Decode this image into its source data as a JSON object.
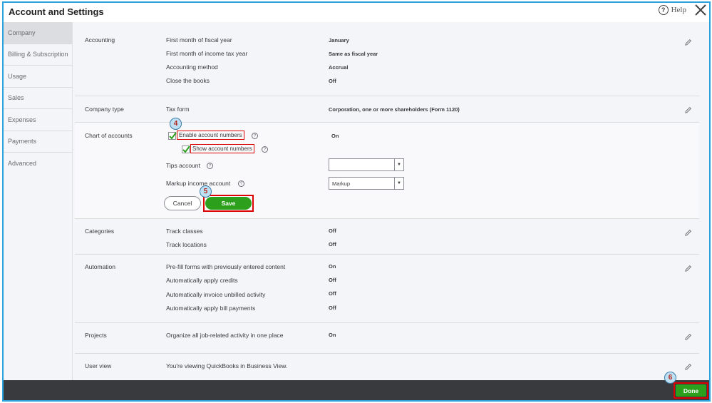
{
  "window": {
    "title": "Account and Settings",
    "help_label": "Help"
  },
  "sidebar": {
    "items": [
      {
        "label": "Company",
        "active": true
      },
      {
        "label": "Billing & Subscription"
      },
      {
        "label": "Usage"
      },
      {
        "label": "Sales"
      },
      {
        "label": "Expenses"
      },
      {
        "label": "Payments"
      },
      {
        "label": "Advanced"
      }
    ]
  },
  "accounting": {
    "label": "Accounting",
    "rows": [
      {
        "label": "First month of fiscal year",
        "value": "January"
      },
      {
        "label": "First month of income tax year",
        "value": "Same as fiscal year"
      },
      {
        "label": "Accounting method",
        "value": "Accrual"
      },
      {
        "label": "Close the books",
        "value": "Off"
      }
    ]
  },
  "company_type": {
    "label": "Company type",
    "row_label": "Tax form",
    "value": "Corporation, one or more shareholders (Form 1120)"
  },
  "chart_of_accounts": {
    "label": "Chart of accounts",
    "enable_label": "Enable account numbers",
    "enable_value": "On",
    "show_label": "Show account numbers",
    "tips_label": "Tips account",
    "tips_value": "",
    "markup_label": "Markup income account",
    "markup_value": "Markup",
    "cancel_label": "Cancel",
    "save_label": "Save"
  },
  "categories": {
    "label": "Categories",
    "rows": [
      {
        "label": "Track classes",
        "value": "Off"
      },
      {
        "label": "Track locations",
        "value": "Off"
      }
    ]
  },
  "automation": {
    "label": "Automation",
    "rows": [
      {
        "label": "Pre-fill forms with previously entered content",
        "value": "On"
      },
      {
        "label": "Automatically apply credits",
        "value": "Off"
      },
      {
        "label": "Automatically invoice unbilled activity",
        "value": "Off"
      },
      {
        "label": "Automatically apply bill payments",
        "value": "Off"
      }
    ]
  },
  "projects": {
    "label": "Projects",
    "row_label": "Organize all job-related activity in one place",
    "value": "On"
  },
  "user_view": {
    "label": "User view",
    "row_label": "You're viewing QuickBooks in Business View."
  },
  "footer": {
    "done_label": "Done"
  },
  "annotations": {
    "step4": "4",
    "step5": "5",
    "step6": "6"
  },
  "colors": {
    "accent_green": "#2ca01c",
    "highlight_red": "#dd0000",
    "frame_blue": "#2aa3dc"
  }
}
